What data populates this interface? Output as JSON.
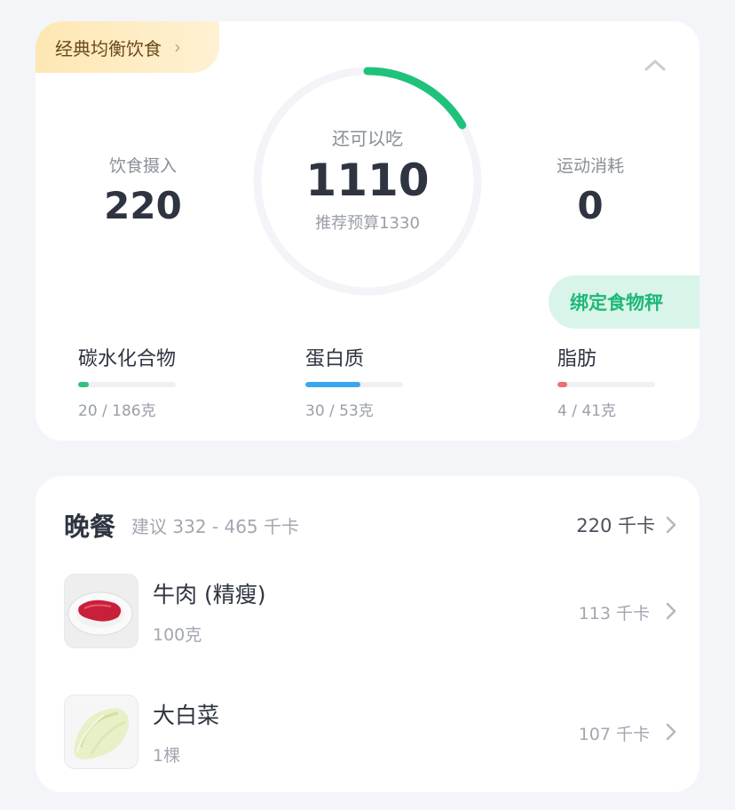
{
  "plan": {
    "label": "经典均衡饮食",
    "chevron": "›"
  },
  "summary": {
    "intake": {
      "label": "饮食摄入",
      "value": "220"
    },
    "remaining": {
      "label": "还可以吃",
      "value": "1110",
      "budget_text": "推荐预算1330",
      "budget_used_fraction": 0.165
    },
    "burned": {
      "label": "运动消耗",
      "value": "0"
    },
    "scale_button": "绑定食物秤"
  },
  "macros": [
    {
      "name": "碳水化合物",
      "amount": "20 / 186克",
      "fraction": 0.107,
      "color": "#2fc27f"
    },
    {
      "name": "蛋白质",
      "amount": "30 / 53克",
      "fraction": 0.566,
      "color": "#3aa6ee"
    },
    {
      "name": "脂肪",
      "amount": "4 / 41克",
      "fraction": 0.098,
      "color": "#f06d6d"
    }
  ],
  "meal": {
    "title": "晚餐",
    "suggestion": "建议 332 - 465 千卡",
    "total": "220 千卡",
    "foods": [
      {
        "name": "牛肉 (精瘦)",
        "quantity": "100克",
        "kcal": "113 千卡",
        "icon": "beef-image"
      },
      {
        "name": "大白菜",
        "quantity": "1棵",
        "kcal": "107 千卡",
        "icon": "napa-cabbage-image"
      }
    ]
  },
  "colors": {
    "accent_green": "#1fb877",
    "ring_track": "#f2f4f7",
    "ring_progress": "#1fc27a"
  }
}
